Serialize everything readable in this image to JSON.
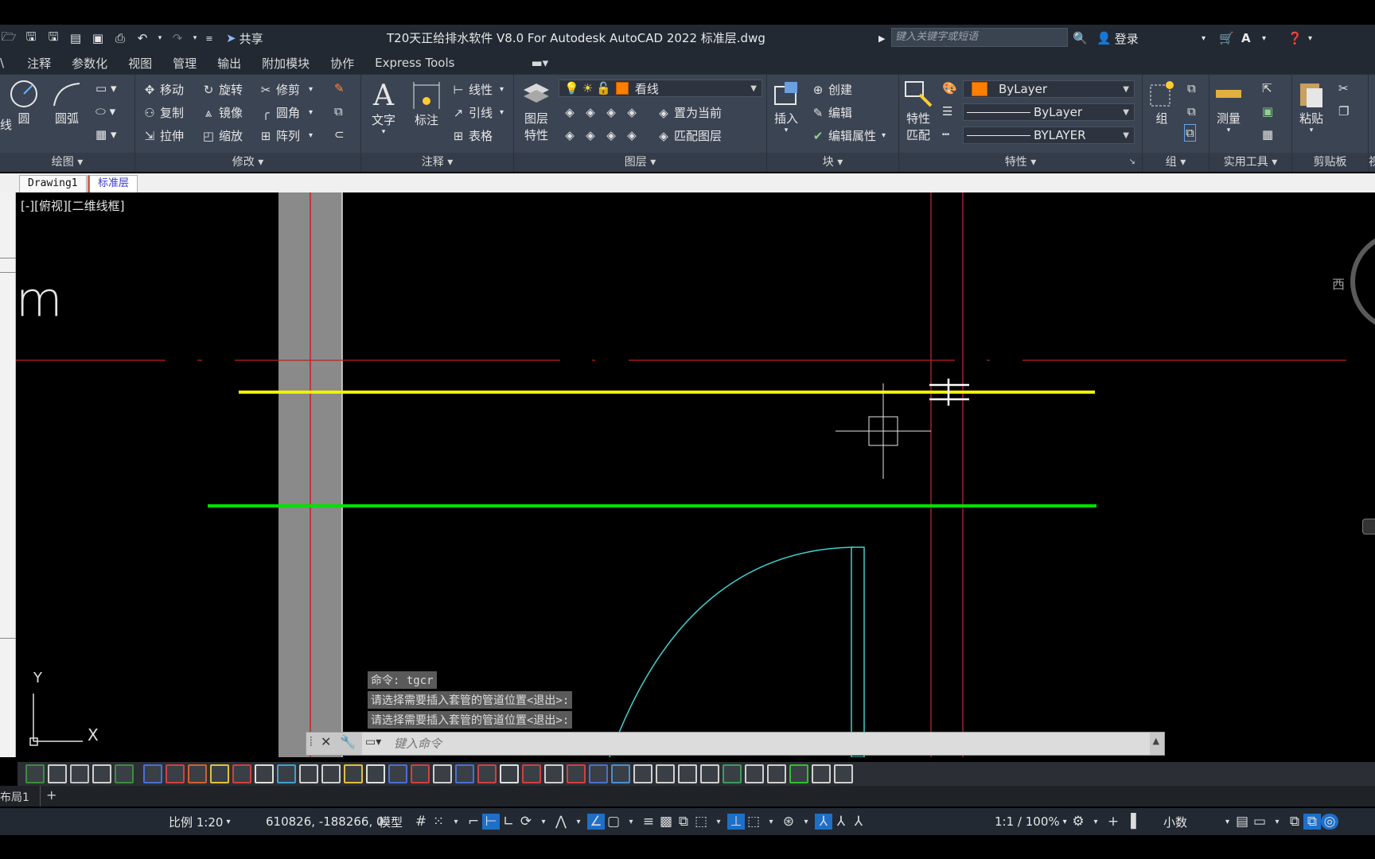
{
  "titlebar": {
    "title": "T20天正给排水软件 V8.0 For Autodesk AutoCAD 2022    标准层.dwg",
    "share_label": "共享",
    "search_placeholder": "键入关键字或短语",
    "login_label": "登录"
  },
  "ribbon_tabs": [
    "注释",
    "参数化",
    "视图",
    "管理",
    "输出",
    "附加模块",
    "协作",
    "Express Tools"
  ],
  "ribbon": {
    "draw": {
      "title": "绘图",
      "line": "线",
      "circle": "圆",
      "arc": "圆弧"
    },
    "modify": {
      "title": "修改",
      "move": "移动",
      "rotate": "旋转",
      "trim": "修剪",
      "copy": "复制",
      "mirror": "镜像",
      "fillet": "圆角",
      "stretch": "拉伸",
      "scale": "缩放",
      "array": "阵列"
    },
    "annotation": {
      "title": "注释",
      "text": "文字",
      "dimension": "标注",
      "linear": "线性",
      "leader": "引线",
      "table": "表格"
    },
    "layers": {
      "title": "图层",
      "layer_props": "图层\n特性",
      "layer_props_a": "图层",
      "layer_props_b": "特性",
      "current_layer": "看线",
      "set_current": "置为当前",
      "match_layer": "匹配图层"
    },
    "block": {
      "title": "块",
      "insert": "插入",
      "create": "创建",
      "edit": "编辑",
      "edit_attr": "编辑属性"
    },
    "properties": {
      "title": "特性",
      "match_a": "特性",
      "match_b": "匹配",
      "color": "ByLayer",
      "linetype": "ByLayer",
      "lineweight": "BYLAYER"
    },
    "groups": {
      "title": "组",
      "group": "组"
    },
    "utilities": {
      "title": "实用工具",
      "measure": "测量"
    },
    "clipboard": {
      "title": "剪贴板",
      "paste": "粘贴"
    },
    "view_cut": "视"
  },
  "doc_tabs": [
    "Drawing1",
    "标准层"
  ],
  "canvas": {
    "view_label": "[-][俯视][二维线框]",
    "viewcube_west": "西",
    "partial_text": "m",
    "ucs_x": "X",
    "ucs_y": "Y"
  },
  "command": {
    "history": [
      "命令: tgcr",
      "请选择需要插入套管的管道位置<退出>:",
      "请选择需要插入套管的管道位置<退出>:"
    ],
    "placeholder": "键入命令"
  },
  "layout_bar": {
    "layout": "布局1",
    "add": "+"
  },
  "status_bar": {
    "scale": "比例 1:20",
    "coords": "610826, -188266, 0",
    "model": "模型",
    "annot_scale": "1:1 / 100%",
    "units": "小数"
  },
  "colors": {
    "accent": "#ff7f00",
    "pipe_yellow": "#f0f000",
    "pipe_green": "#00e000",
    "axis_red": "#d02020",
    "door_cyan": "#40d0d0",
    "ribbon_bg": "#3b4453",
    "title_bg": "#222933"
  }
}
